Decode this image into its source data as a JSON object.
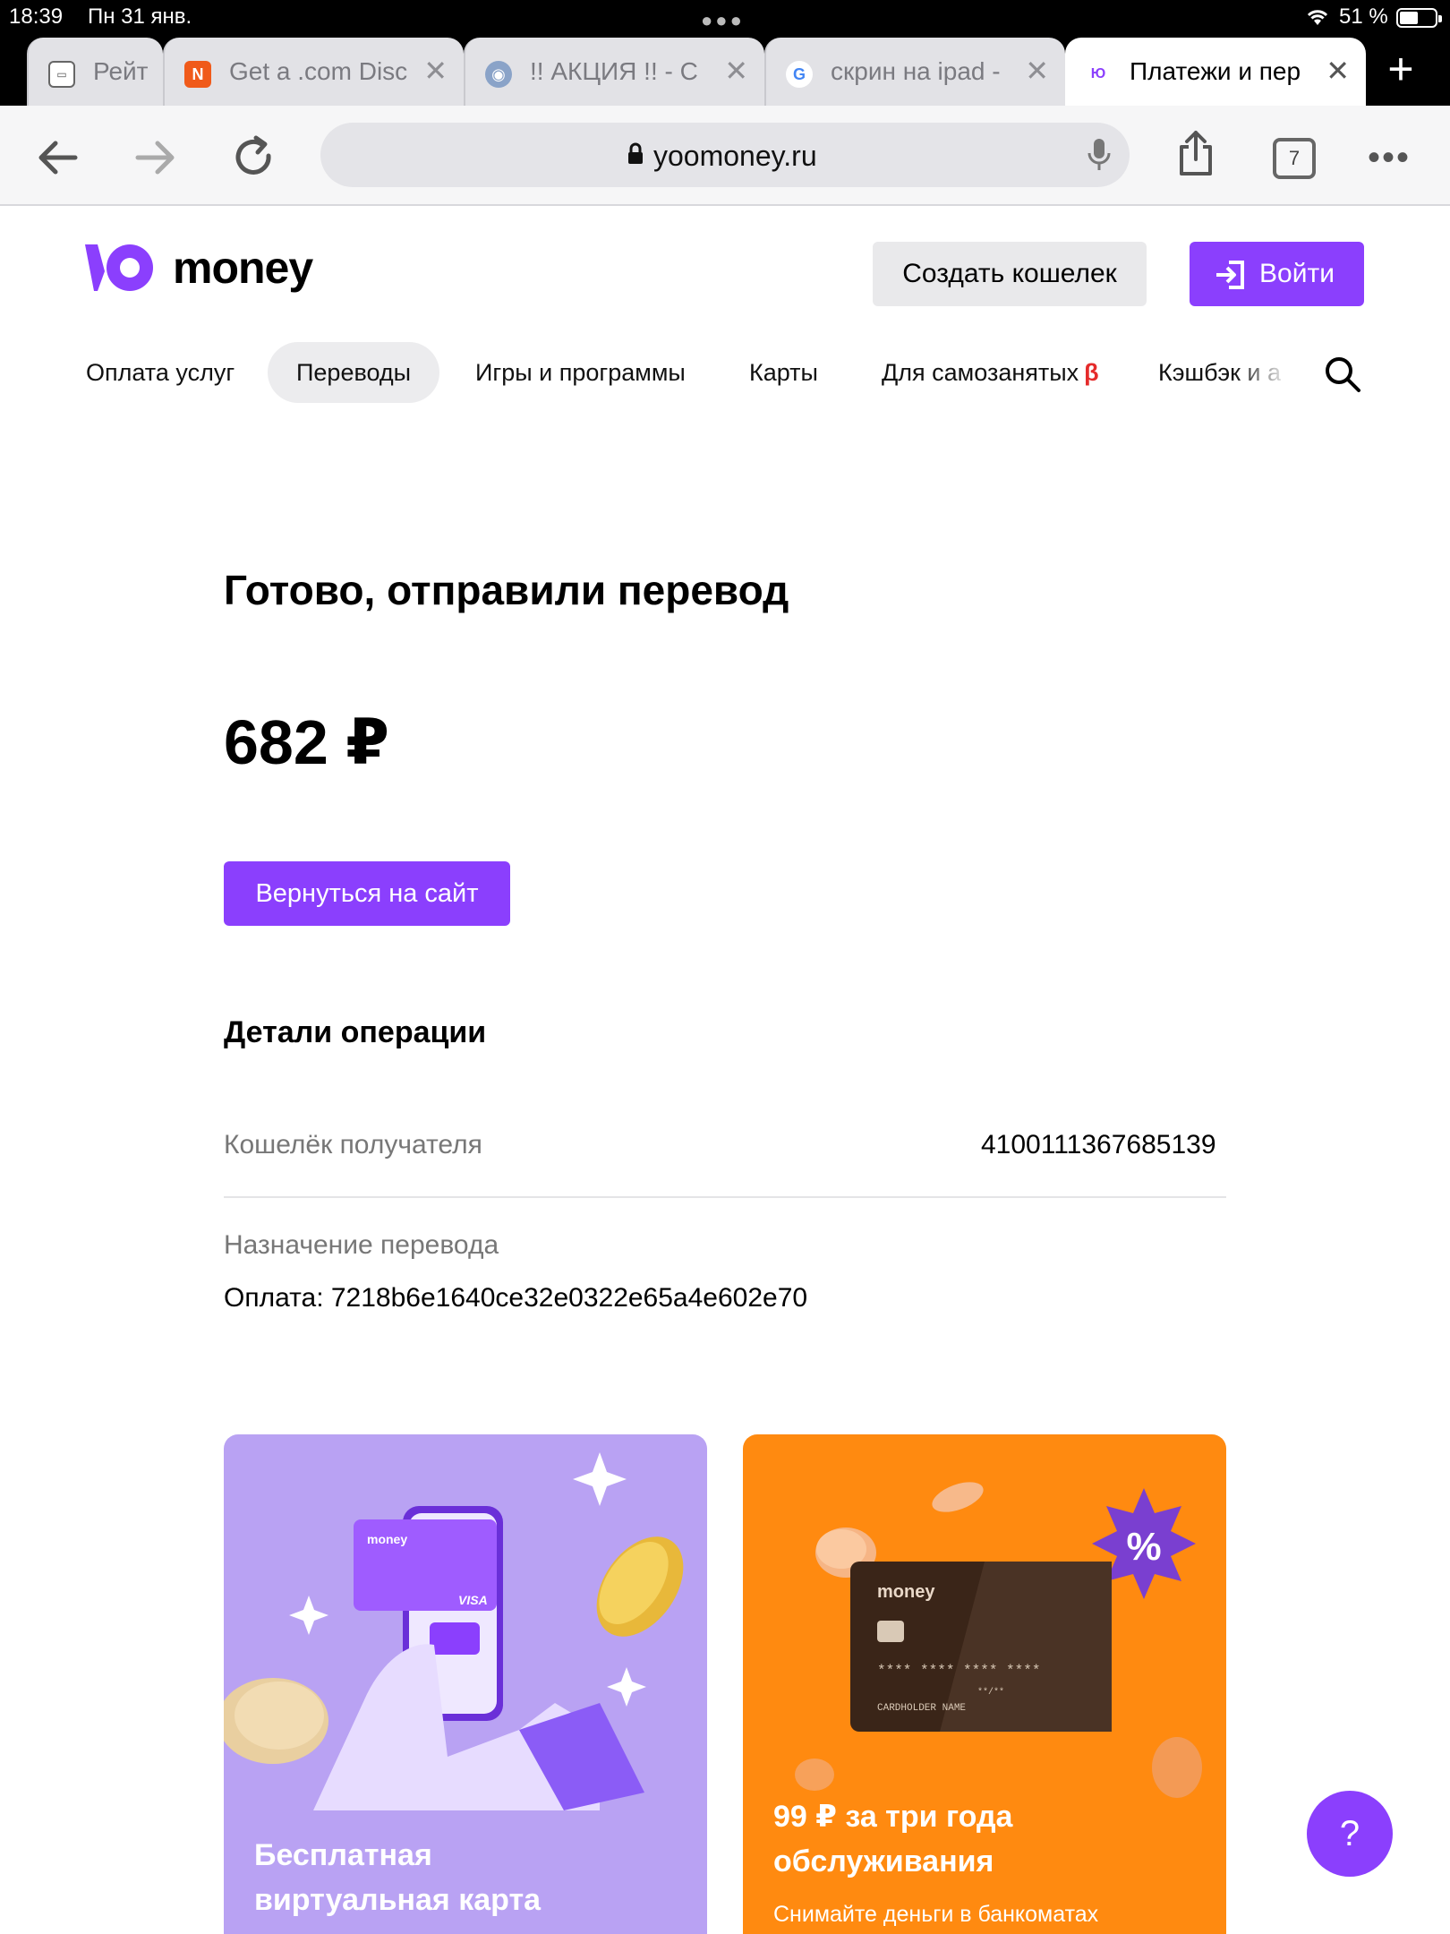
{
  "status_bar": {
    "time": "18:39",
    "date": "Пн 31 янв.",
    "battery": "51 %"
  },
  "browser": {
    "tabs": [
      {
        "title": "Рейт",
        "favicon": "chat-icon"
      },
      {
        "title": "Get a .com Disc",
        "favicon": "namecheap-icon"
      },
      {
        "title": "!! АКЦИЯ !! - C",
        "favicon": "globe-icon"
      },
      {
        "title": "скрин на ipad -",
        "favicon": "google-icon"
      },
      {
        "title": "Платежи и пер",
        "favicon": "yoomoney-icon",
        "active": true
      }
    ],
    "url": "yoomoney.ru",
    "tabs_count": "7"
  },
  "site": {
    "logo_text": "money",
    "create_wallet": "Создать кошелек",
    "login": "Войти",
    "menu": [
      {
        "label": "Оплата услуг"
      },
      {
        "label": "Переводы",
        "active": true
      },
      {
        "label": "Игры и программы"
      },
      {
        "label": "Карты"
      },
      {
        "label": "Для самозанятых",
        "badge": "β"
      },
      {
        "label": "Кэшбэк и а"
      }
    ]
  },
  "result": {
    "title": "Готово, отправили перевод",
    "amount": "682 ₽",
    "back_button": "Вернуться на сайт",
    "details_title": "Детали операции",
    "recipient_label": "Кошелёк получателя",
    "recipient_value": "4100111367685139",
    "purpose_label": "Назначение перевода",
    "purpose_value": "Оплата: 7218b6e1640ce32e0322e65a4e602e70"
  },
  "promos": [
    {
      "title_line1": "Бесплатная",
      "title_line2": "виртуальная карта",
      "card_brand": "money",
      "card_network": "VISA",
      "color": "#b9a2f3"
    },
    {
      "title_line1": "99 ₽ за три года",
      "title_line2": "обслуживания",
      "subtitle": "Снимайте деньги в банкоматах",
      "card_brand": "money",
      "card_number": "**** **** **** ****",
      "card_holder": "CARDHOLDER NAME",
      "card_expiry": "**/**",
      "badge": "%",
      "color": "#ff8a10"
    }
  ],
  "help_label": "?",
  "colors": {
    "accent": "#8b3ffd",
    "beta": "#e52b2b"
  }
}
